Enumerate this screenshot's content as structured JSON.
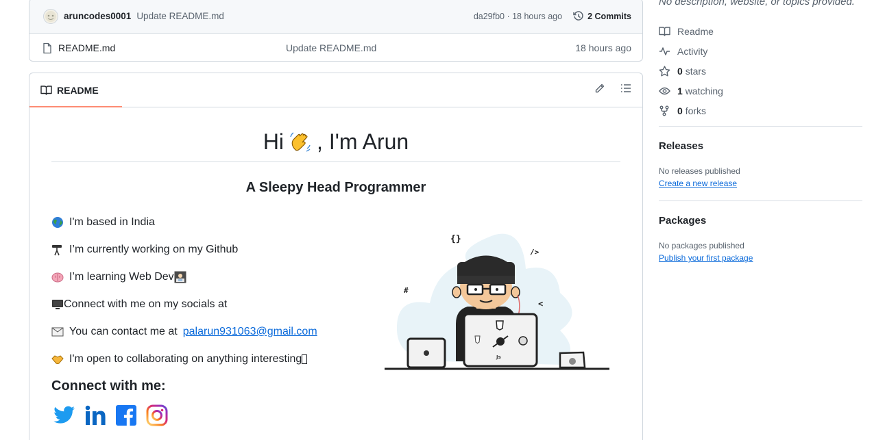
{
  "latest_commit": {
    "user": "aruncodes0001",
    "message": "Update README.md",
    "meta": "da29fb0 · 18 hours ago",
    "commits_label": "2 Commits"
  },
  "files": [
    {
      "name": "README.md",
      "message": "Update README.md",
      "time": "18 hours ago"
    }
  ],
  "readme": {
    "tab_label": "README",
    "heading_pre": "Hi",
    "heading_post": ", I'm Arun",
    "subheading": "A Sleepy Head Programmer",
    "facts": [
      {
        "icon": "globe-icon",
        "text": "I'm based in India"
      },
      {
        "icon": "telescope-icon",
        "text": "I’m currently working on my Github"
      },
      {
        "icon": "brain-icon",
        "text": "I’m learning Web Dev"
      },
      {
        "icon": "computer-icon",
        "text": "Connect with me on my socials at"
      },
      {
        "icon": "envelope-icon",
        "text_pre": "You can contact me at",
        "email": "palarun931063@gmail.com"
      },
      {
        "icon": "handshake-icon",
        "text": "I'm open to collaborating on anything interesting"
      }
    ],
    "connect_heading": "Connect with me:",
    "socials": [
      "twitter-icon",
      "linkedin-icon",
      "facebook-icon",
      "instagram-icon"
    ]
  },
  "sidebar": {
    "description": "No description, website, or topics provided.",
    "links": {
      "readme": "Readme",
      "activity": "Activity",
      "stars_count": "0",
      "stars_label": "stars",
      "watching_count": "1",
      "watching_label": "watching",
      "forks_count": "0",
      "forks_label": "forks"
    },
    "releases": {
      "title": "Releases",
      "empty": "No releases published",
      "link": "Create a new release"
    },
    "packages": {
      "title": "Packages",
      "empty": "No packages published",
      "link": "Publish your first package"
    }
  },
  "colors": {
    "accent_link": "#0969da",
    "tab_underline": "#fd8c73",
    "muted_text": "#59636e",
    "border": "#d0d7de"
  }
}
